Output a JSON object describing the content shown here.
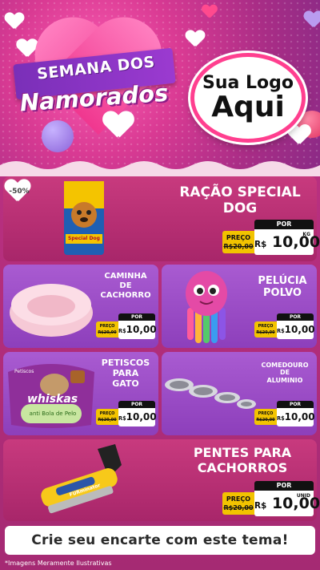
{
  "header": {
    "title_line1": "SEMANA DOS",
    "title_line2": "Namorados",
    "logo_line1": "Sua Logo",
    "logo_line2": "Aqui"
  },
  "badge": {
    "text": "-50%"
  },
  "products": [
    {
      "name_l1": "RAÇÃO SPECIAL",
      "name_l2": "DOG",
      "name_l3": "",
      "preco_label": "PREÇO",
      "old_price": "R$20,00",
      "por_label": "POR",
      "new_currency": "R$",
      "new_price": "10,00",
      "unit": "KG"
    },
    {
      "name_l1": "CAMINHA",
      "name_l2": "DE",
      "name_l3": "CACHORRO",
      "preco_label": "PREÇO",
      "old_price": "R$20,00",
      "por_label": "POR",
      "new_currency": "R$",
      "new_price": "10,00",
      "unit": ""
    },
    {
      "name_l1": "PELÚCIA",
      "name_l2": "POLVO",
      "name_l3": "",
      "preco_label": "PREÇO",
      "old_price": "R$20,00",
      "por_label": "POR",
      "new_currency": "R$",
      "new_price": "10,00",
      "unit": ""
    },
    {
      "name_l1": "PETISCOS",
      "name_l2": "PARA",
      "name_l3": "GATO",
      "preco_label": "PREÇO",
      "old_price": "R$20,00",
      "por_label": "POR",
      "new_currency": "R$",
      "new_price": "10,00",
      "unit": ""
    },
    {
      "name_l1": "COMEDOURO",
      "name_l2": "DE",
      "name_l3": "ALUMINIO",
      "preco_label": "PREÇO",
      "old_price": "R$20,00",
      "por_label": "POR",
      "new_currency": "R$",
      "new_price": "10,00",
      "unit": ""
    },
    {
      "name_l1": "PENTES PARA",
      "name_l2": "CACHORROS",
      "name_l3": "",
      "preco_label": "PREÇO",
      "old_price": "R$20,00",
      "por_label": "POR",
      "new_currency": "R$",
      "new_price": "10,00",
      "unit": "UNID"
    }
  ],
  "packaging": {
    "special_dog_brand": "Special Dog",
    "whiskas_top": "Petiscos",
    "whiskas_brand": "whiskas",
    "whiskas_sub": "anti Bola de Pelo",
    "comb_brand": "FURminator"
  },
  "footer": {
    "cta": "Crie seu encarte com este tema!",
    "note": "*Imagens Meramente Ilustrativas"
  },
  "colors": {
    "magenta": "#c83a7e",
    "purple": "#a95bd1",
    "yellow": "#f2c300",
    "black": "#111111"
  },
  "icons": [
    "heart-icon",
    "logo-circle"
  ]
}
